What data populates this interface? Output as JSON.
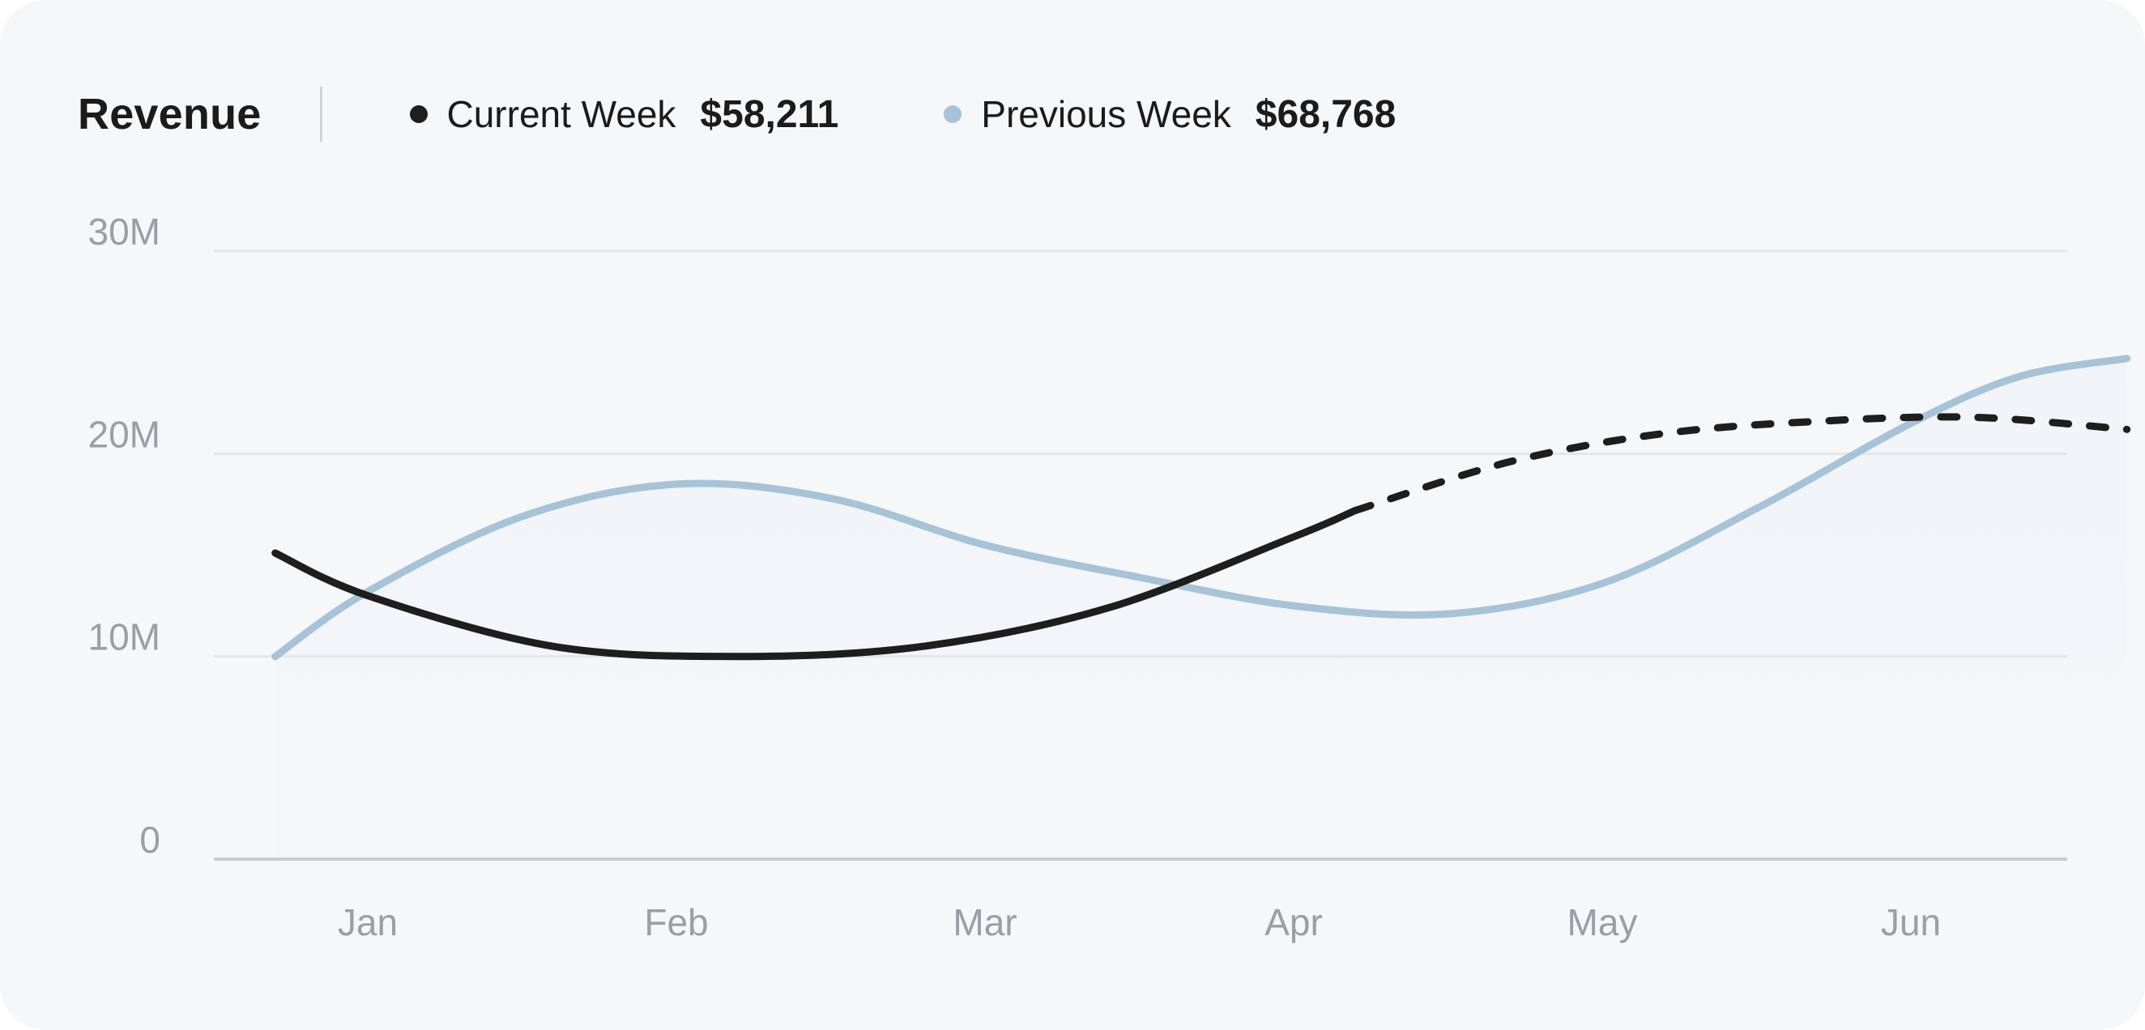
{
  "header": {
    "title": "Revenue",
    "legend": [
      {
        "label": "Current Week",
        "value": "$58,211",
        "color": "#1e1e1e"
      },
      {
        "label": "Previous Week",
        "value": "$68,768",
        "color": "#a7c3d8"
      }
    ]
  },
  "chart_data": {
    "type": "line",
    "title": "Revenue",
    "xlabel": "",
    "ylabel": "",
    "categories": [
      "Jan",
      "Feb",
      "Mar",
      "Apr",
      "May",
      "Jun"
    ],
    "y_ticks": [
      {
        "value": 0,
        "label": "0"
      },
      {
        "value": 10,
        "label": "10M"
      },
      {
        "value": 20,
        "label": "20M"
      },
      {
        "value": 30,
        "label": "30M"
      }
    ],
    "ylim": [
      0,
      30
    ],
    "x_range": [
      -0.3,
      5.7
    ],
    "grid": true,
    "series": [
      {
        "name": "Current Week",
        "color": "#1e1e1e",
        "dashed_from_x": 3.2,
        "points": [
          {
            "x": -0.3,
            "y": 15.1
          },
          {
            "x": 0.0,
            "y": 13.0
          },
          {
            "x": 0.6,
            "y": 10.5
          },
          {
            "x": 1.2,
            "y": 10.0
          },
          {
            "x": 1.8,
            "y": 10.5
          },
          {
            "x": 2.4,
            "y": 12.4
          },
          {
            "x": 3.0,
            "y": 15.9
          },
          {
            "x": 3.2,
            "y": 17.2
          },
          {
            "x": 3.7,
            "y": 19.6
          },
          {
            "x": 4.2,
            "y": 21.0
          },
          {
            "x": 4.7,
            "y": 21.6
          },
          {
            "x": 5.2,
            "y": 21.8
          },
          {
            "x": 5.7,
            "y": 21.2
          }
        ]
      },
      {
        "name": "Previous Week",
        "color": "#a7c3d8",
        "points": [
          {
            "x": -0.3,
            "y": 10.0
          },
          {
            "x": 0.0,
            "y": 13.2
          },
          {
            "x": 0.5,
            "y": 16.9
          },
          {
            "x": 1.0,
            "y": 18.5
          },
          {
            "x": 1.5,
            "y": 17.8
          },
          {
            "x": 2.0,
            "y": 15.5
          },
          {
            "x": 2.5,
            "y": 13.9
          },
          {
            "x": 3.0,
            "y": 12.5
          },
          {
            "x": 3.5,
            "y": 12.1
          },
          {
            "x": 4.0,
            "y": 13.6
          },
          {
            "x": 4.5,
            "y": 17.3
          },
          {
            "x": 5.0,
            "y": 21.5
          },
          {
            "x": 5.35,
            "y": 23.8
          },
          {
            "x": 5.7,
            "y": 24.7
          }
        ]
      }
    ]
  }
}
